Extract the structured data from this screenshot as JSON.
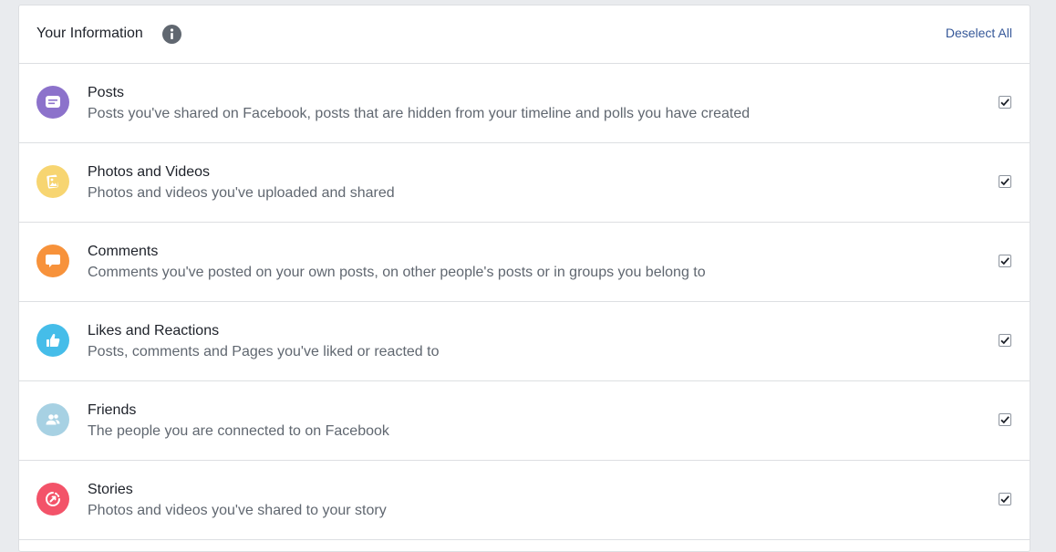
{
  "header": {
    "title": "Your Information",
    "info_icon": "info-icon",
    "deselect_label": "Deselect All"
  },
  "colors": {
    "posts": "#8c72cb",
    "photos": "#f7d571",
    "comments": "#f7923b",
    "likes": "#45bde9",
    "friends": "#a7d1e3",
    "stories": "#f35369",
    "link": "#365899"
  },
  "items": [
    {
      "title": "Posts",
      "description": "Posts you've shared on Facebook, posts that are hidden from your timeline and polls you have created",
      "icon": "posts-icon",
      "checked": true
    },
    {
      "title": "Photos and Videos",
      "description": "Photos and videos you've uploaded and shared",
      "icon": "photos-icon",
      "checked": true
    },
    {
      "title": "Comments",
      "description": "Comments you've posted on your own posts, on other people's posts or in groups you belong to",
      "icon": "comments-icon",
      "checked": true
    },
    {
      "title": "Likes and Reactions",
      "description": "Posts, comments and Pages you've liked or reacted to",
      "icon": "likes-icon",
      "checked": true
    },
    {
      "title": "Friends",
      "description": "The people you are connected to on Facebook",
      "icon": "friends-icon",
      "checked": true
    },
    {
      "title": "Stories",
      "description": "Photos and videos you've shared to your story",
      "icon": "stories-icon",
      "checked": true
    }
  ]
}
